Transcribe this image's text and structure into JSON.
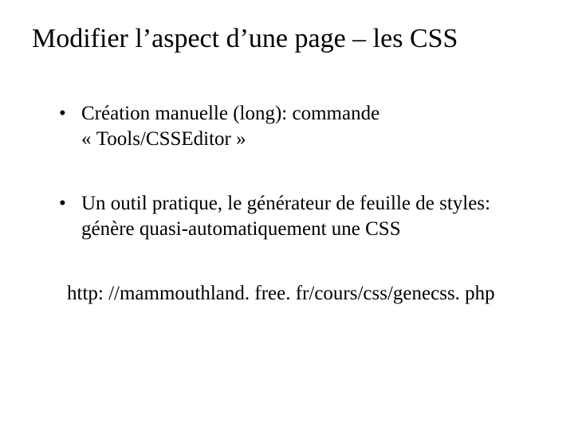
{
  "title": "Modifier l’aspect d’une page – les CSS",
  "bullets": [
    "Création manuelle (long): commande « Tools/CSSEditor »",
    "Un outil pratique, le générateur de feuille de styles: génère quasi-automatiquement une CSS"
  ],
  "link": "http: //mammouthland. free. fr/cours/css/genecss. php"
}
